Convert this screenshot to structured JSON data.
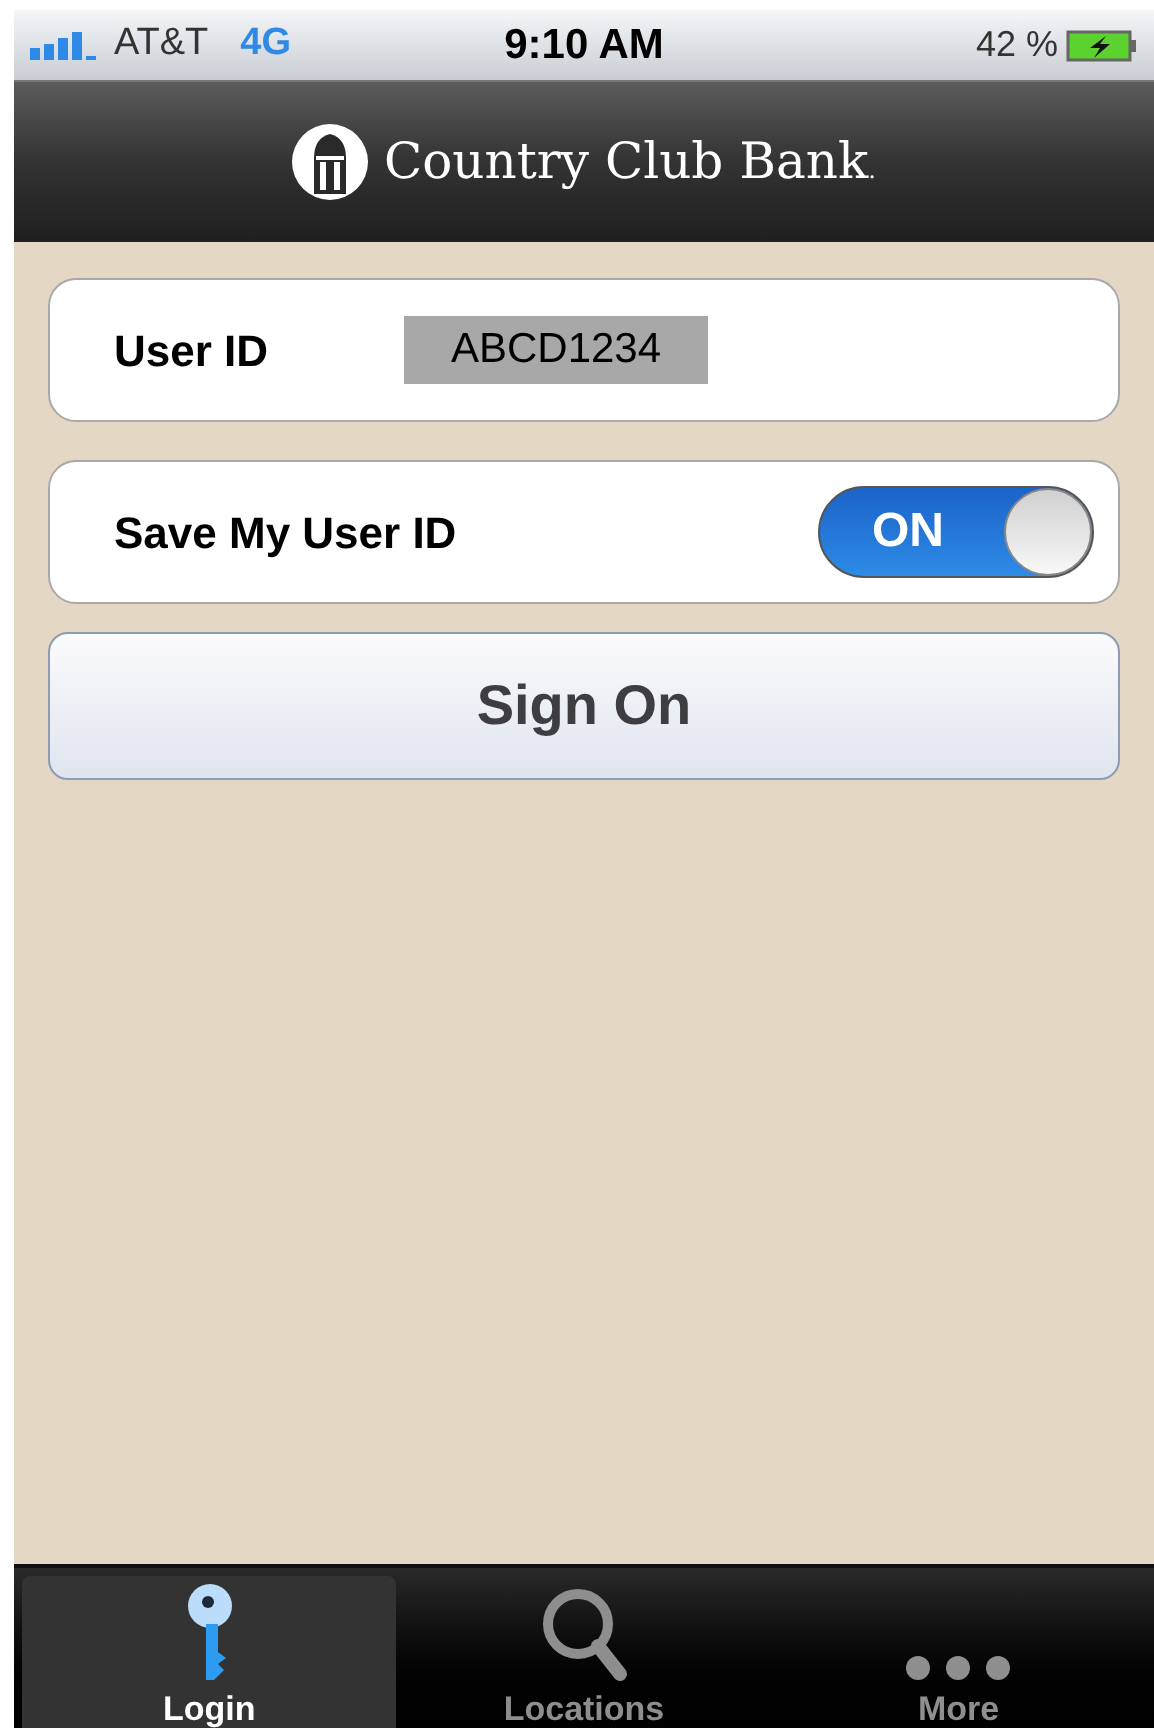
{
  "status_bar": {
    "carrier": "AT&T",
    "network": "4G",
    "time": "9:10 AM",
    "battery": "42 %"
  },
  "nav_bar": {
    "title": "Country Club Bank",
    "mark": "."
  },
  "form": {
    "user_id": {
      "label": "User ID",
      "value": "ABCD1234"
    },
    "save_user_id": {
      "label": "Save My User ID",
      "on": true,
      "on_text": "ON"
    },
    "sign_on": "Sign On"
  },
  "tabs": [
    {
      "label": "Login",
      "kind": "key",
      "selected": true
    },
    {
      "label": "Locations",
      "kind": "search",
      "selected": false
    },
    {
      "label": "More",
      "kind": "more",
      "selected": false
    }
  ]
}
